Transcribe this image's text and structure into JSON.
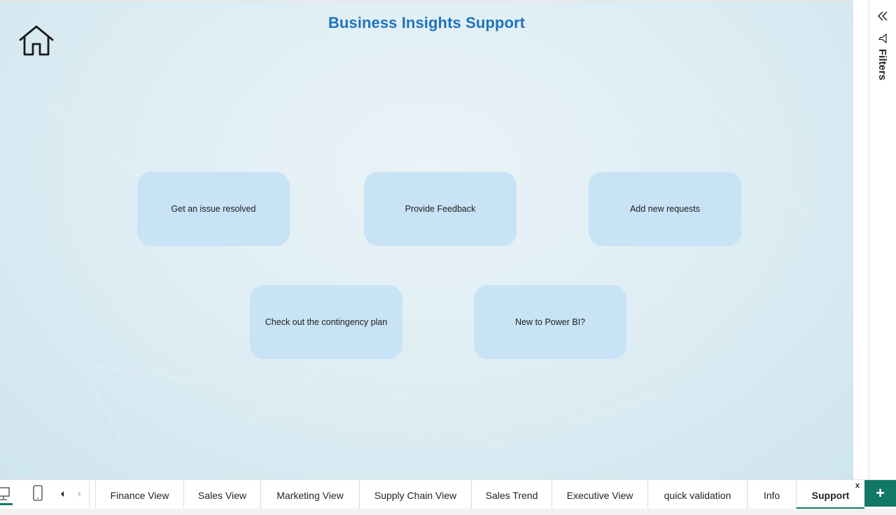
{
  "report": {
    "title": "Business Insights Support",
    "home_icon": "home-icon",
    "accent_color": "#1e73be",
    "tile_color": "#c8e2f6"
  },
  "tiles": [
    {
      "label": "Get an issue resolved"
    },
    {
      "label": "Provide Feedback"
    },
    {
      "label": "Add new requests"
    },
    {
      "label": "Check out the contingency plan"
    },
    {
      "label": "New to Power BI?"
    }
  ],
  "filters_pane": {
    "label": "Filters",
    "collapse_icon": "double-chevron-left-icon",
    "filter_icon": "funnel-icon"
  },
  "tabbar": {
    "tabs": [
      {
        "label": "Finance View"
      },
      {
        "label": "Sales View"
      },
      {
        "label": "Marketing View"
      },
      {
        "label": "Supply Chain View"
      },
      {
        "label": "Sales Trend"
      },
      {
        "label": "Executive View"
      },
      {
        "label": "quick validation"
      },
      {
        "label": "Info"
      },
      {
        "label": "Support"
      }
    ],
    "active_tab": "Support",
    "close_label": "x",
    "add_label": "+",
    "active_color": "#117865"
  }
}
